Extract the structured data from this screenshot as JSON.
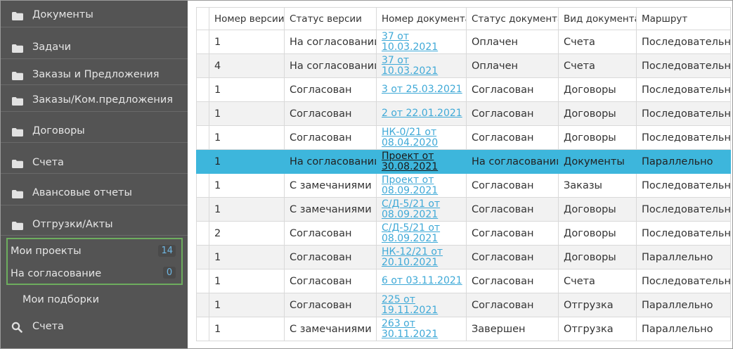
{
  "sidebar": {
    "items": [
      {
        "label": "Документы"
      },
      {
        "label": "Задачи"
      },
      {
        "label": "Заказы и Предложения"
      },
      {
        "label": "Заказы/Ком.предложения"
      },
      {
        "label": "Договоры"
      },
      {
        "label": "Счета"
      },
      {
        "label": "Авансовые отчеты"
      },
      {
        "label": "Отгрузки/Акты"
      }
    ],
    "my_projects": {
      "label": "Мои проекты",
      "count": "14"
    },
    "on_approval": {
      "label": "На согласование",
      "count": "0"
    },
    "my_selections": "Мои подборки",
    "search": {
      "label": "Счета",
      "icon": "search-icon"
    }
  },
  "table": {
    "columns": [
      "Номер версии",
      "Статус версии",
      "Номер документа",
      "Статус документа",
      "Вид документа",
      "Маршрут"
    ],
    "rows": [
      {
        "version": "1",
        "version_status": "На согласовании",
        "doc_l1": "37 от",
        "doc_l2": "10.03.2021",
        "doc_status": "Оплачен",
        "doc_type": "Счета",
        "route": "Последовательно"
      },
      {
        "version": "4",
        "version_status": "На согласовании",
        "doc_l1": "37 от",
        "doc_l2": "10.03.2021",
        "doc_status": "Оплачен",
        "doc_type": "Счета",
        "route": "Последовательно"
      },
      {
        "version": "1",
        "version_status": "Согласован",
        "doc_l1": "3 от 25.03.2021",
        "doc_l2": "",
        "doc_status": "Согласован",
        "doc_type": "Договоры",
        "route": "Последовательно"
      },
      {
        "version": "1",
        "version_status": "Согласован",
        "doc_l1": "2 от 22.01.2021",
        "doc_l2": "",
        "doc_status": "Согласован",
        "doc_type": "Договоры",
        "route": "Последовательно"
      },
      {
        "version": "1",
        "version_status": "Согласован",
        "doc_l1": "НК-0/21 от",
        "doc_l2": "08.04.2020",
        "doc_status": "Согласован",
        "doc_type": "Договоры",
        "route": "Последовательно"
      },
      {
        "version": "1",
        "version_status": "На согласовании",
        "doc_l1": "Проект от",
        "doc_l2": "30.08.2021",
        "doc_status": "На согласовании",
        "doc_type": "Документы",
        "route": "Параллельно"
      },
      {
        "version": "1",
        "version_status": "С замечаниями",
        "doc_l1": "Проект от",
        "doc_l2": "08.09.2021",
        "doc_status": "Согласован",
        "doc_type": "Заказы",
        "route": "Последовательно"
      },
      {
        "version": "1",
        "version_status": "С замечаниями",
        "doc_l1": "С/Д-5/21 от",
        "doc_l2": "08.09.2021",
        "doc_status": "Согласован",
        "doc_type": "Договоры",
        "route": "Последовательно"
      },
      {
        "version": "2",
        "version_status": "Согласован",
        "doc_l1": "С/Д-5/21 от",
        "doc_l2": "08.09.2021",
        "doc_status": "Согласован",
        "doc_type": "Договоры",
        "route": "Последовательно"
      },
      {
        "version": "1",
        "version_status": "Согласован",
        "doc_l1": "НК-12/21 от",
        "doc_l2": "20.10.2021",
        "doc_status": "Согласован",
        "doc_type": "Договоры",
        "route": "Параллельно"
      },
      {
        "version": "1",
        "version_status": "Согласован",
        "doc_l1": "6 от 03.11.2021",
        "doc_l2": "",
        "doc_status": "Согласован",
        "doc_type": "Счета",
        "route": "Последовательно"
      },
      {
        "version": "1",
        "version_status": "Согласован",
        "doc_l1": "225 от",
        "doc_l2": "19.11.2021",
        "doc_status": "Согласован",
        "doc_type": "Отгрузка",
        "route": "Параллельно"
      },
      {
        "version": "1",
        "version_status": "С замечаниями",
        "doc_l1": "263 от",
        "doc_l2": "30.11.2021",
        "doc_status": "Завершен",
        "doc_type": "Отгрузка",
        "route": "Параллельно"
      }
    ],
    "selected_row": 5
  },
  "colors": {
    "sidebar_bg": "#545454",
    "highlight_row": "#3db6dc",
    "link": "#3fa9d7",
    "box_border": "#6dad5e"
  }
}
